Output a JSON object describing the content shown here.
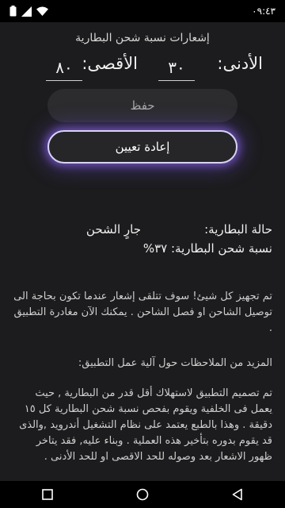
{
  "status_bar": {
    "time": "٠٩:٤٣"
  },
  "screen": {
    "title": "إشعارات نسبة شحن البطارية",
    "min_label": "الأدنى:",
    "min_value": "٣٠",
    "max_label": "الأقصى:",
    "max_value": "٨٠",
    "save_label": "حفظ",
    "reset_label": "إعادة تعيين",
    "battery_state_label": "حالة البطارية:",
    "battery_state_value": "جارٍ الشحن",
    "battery_percent_line": "نسبة شحن البطارية: ٣٧%",
    "ready_text": "تم تجهيز كل شيئ! سوف تتلقى إشعار عندما تكون بحاجة الى توصيل الشاحن او فصل الشاحن . يمكنك الآن مغادرة التطبيق .",
    "more_notes_heading": "المزيد من الملاحظات حول آلية عمل التطبيق:",
    "notes_text": "تم تصميم التطبيق لاستهلاك أقل قدر من البطارية , حيث يعمل فى الخلفية ويقوم بفحص نسبة شحن البطارية كل ١٥ دقيقة . وهذا بالطبع يعتمد على نظام التشغيل أندرويد ,والذى قد يقوم بدوره بتأخير هذه العملية . وبناء عليه, فقد يتاخر ظهور الاشعار بعد وصوله للحد الاقصى او للحد الأدنى ."
  },
  "icons": {
    "wifi": "wifi-icon",
    "signal": "signal-icon",
    "battery": "battery-icon",
    "back": "back-icon",
    "home": "home-icon",
    "recents": "recents-icon"
  }
}
